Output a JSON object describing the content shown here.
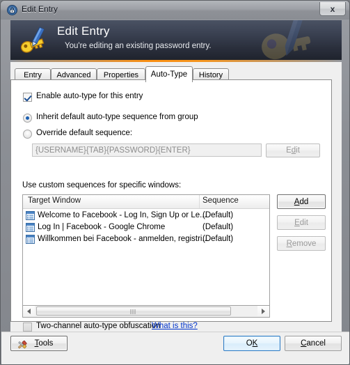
{
  "window": {
    "title": "Edit Entry",
    "title_icon": "lock-circle-icon",
    "close_label": "x"
  },
  "banner": {
    "title": "Edit Entry",
    "subtitle": "You're editing an existing password entry.",
    "icon": "key-pencil-icon",
    "accent_color": "#ff8e0a",
    "bg_color": "#2a2f3c"
  },
  "tabs": [
    {
      "label": "Entry",
      "selected": false
    },
    {
      "label": "Advanced",
      "selected": false
    },
    {
      "label": "Properties",
      "selected": false
    },
    {
      "label": "Auto-Type",
      "selected": true
    },
    {
      "label": "History",
      "selected": false
    }
  ],
  "autotype": {
    "enable_checkbox": {
      "label": "Enable auto-type for this entry",
      "checked": true
    },
    "radio_inherit": {
      "label": "Inherit default auto-type sequence from group",
      "selected": true
    },
    "radio_override": {
      "label": "Override default sequence:",
      "selected": false
    },
    "sequence_field": {
      "value": "{USERNAME}{TAB}{PASSWORD}{ENTER}",
      "enabled": false
    },
    "sequence_edit_button": {
      "label_pre": "E",
      "label_accel": "d",
      "label_post": "it",
      "enabled": false
    },
    "custom_label": "Use custom sequences for specific windows:",
    "columns": [
      "Target Window",
      "Sequence"
    ],
    "rows": [
      {
        "icon": "window-list-icon",
        "target": "Welcome to Facebook - Log In, Sign Up or Le...",
        "sequence": "(Default)"
      },
      {
        "icon": "window-list-icon",
        "target": "Log In | Facebook - Google Chrome",
        "sequence": "(Default)"
      },
      {
        "icon": "window-list-icon",
        "target": "Willkommen bei Facebook - anmelden, registri...",
        "sequence": "(Default)"
      }
    ],
    "side_buttons": [
      {
        "label_pre": "",
        "label_accel": "A",
        "label_post": "dd",
        "enabled": true,
        "focused": true,
        "name": "add-button"
      },
      {
        "label_pre": "",
        "label_accel": "E",
        "label_post": "dit",
        "enabled": false,
        "focused": false,
        "name": "edit-button"
      },
      {
        "label_pre": "",
        "label_accel": "R",
        "label_post": "emove",
        "enabled": false,
        "focused": false,
        "name": "remove-button"
      }
    ],
    "obfuscation_checkbox": {
      "label": "Two-channel auto-type obfuscation",
      "checked": false
    },
    "help_link": "What is this?"
  },
  "footer": {
    "tools": {
      "label_pre": "",
      "label_accel": "T",
      "label_post": "ools",
      "icon": "tools-icon"
    },
    "ok": {
      "label_pre": "O",
      "label_accel": "K",
      "label_post": "",
      "is_default": true
    },
    "cancel": {
      "label_pre": "",
      "label_accel": "C",
      "label_post": "ancel",
      "is_default": false
    }
  }
}
